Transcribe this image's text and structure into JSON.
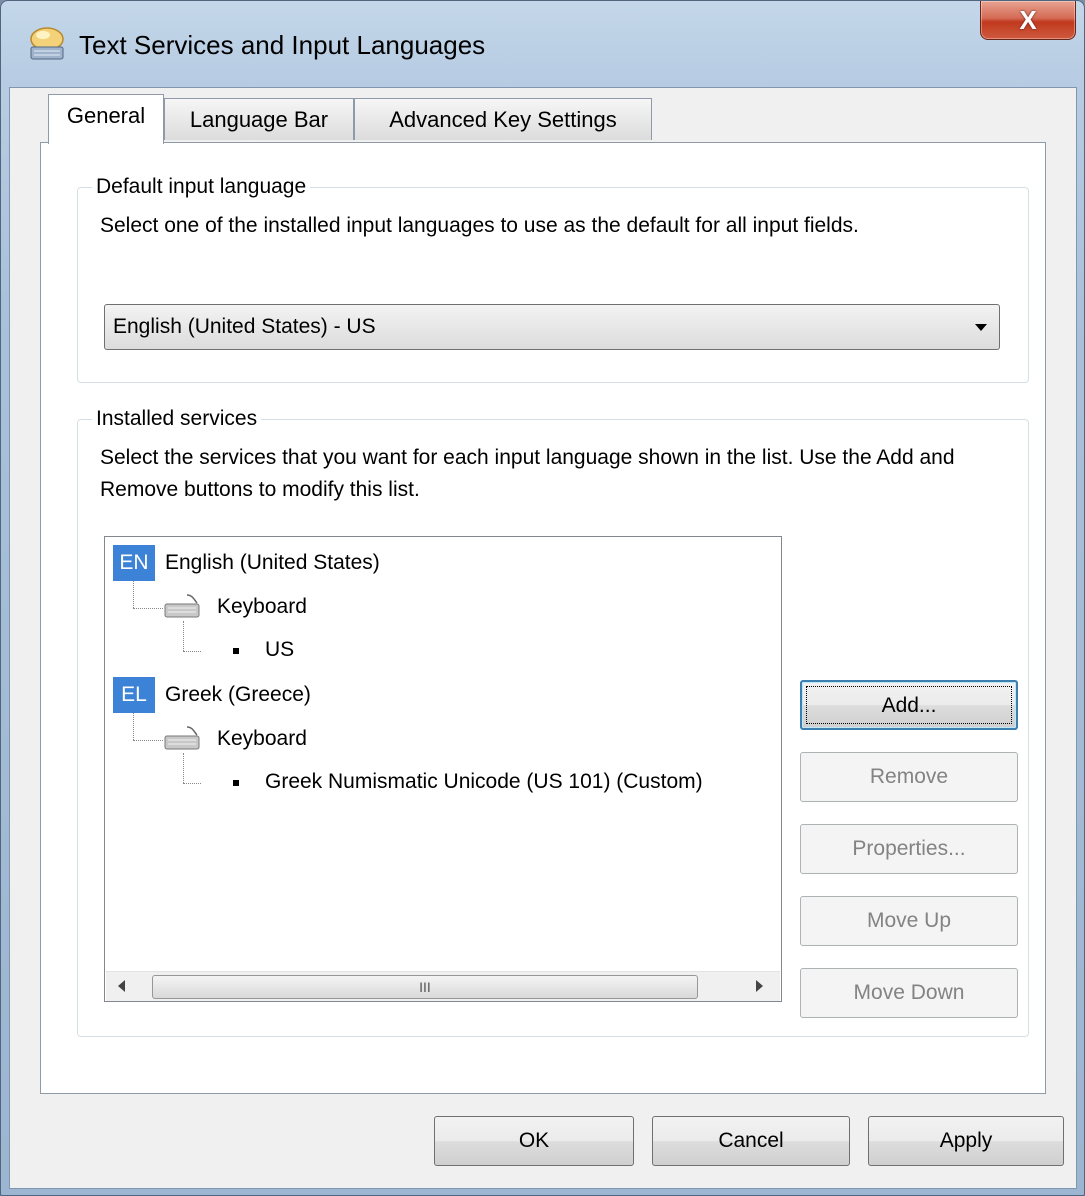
{
  "window": {
    "title": "Text Services and Input Languages",
    "close_glyph": "X"
  },
  "tabs": [
    {
      "label": "General",
      "active": true
    },
    {
      "label": "Language Bar",
      "active": false
    },
    {
      "label": "Advanced Key Settings",
      "active": false
    }
  ],
  "default_input": {
    "legend": "Default input language",
    "description": "Select one of the installed input languages to use as the default for all input fields.",
    "selected": "English (United States) - US"
  },
  "installed_services": {
    "legend": "Installed services",
    "description": "Select the services that you want for each input language shown in the list. Use the Add and Remove buttons to modify this list.",
    "tree": [
      {
        "badge": "EN",
        "language": "English (United States)",
        "category": "Keyboard",
        "layout": "US"
      },
      {
        "badge": "EL",
        "language": "Greek (Greece)",
        "category": "Keyboard",
        "layout": "Greek Numismatic Unicode (US 101) (Custom)"
      }
    ],
    "scroll_thumb_glyph": "III"
  },
  "side_buttons": {
    "add": "Add...",
    "remove": "Remove",
    "properties": "Properties...",
    "move_up": "Move Up",
    "move_down": "Move Down"
  },
  "footer": {
    "ok": "OK",
    "cancel": "Cancel",
    "apply": "Apply"
  },
  "colors": {
    "lang_badge": "#3c82d6",
    "close_button": "#c0391e",
    "title_bar": "#b8cde3"
  }
}
